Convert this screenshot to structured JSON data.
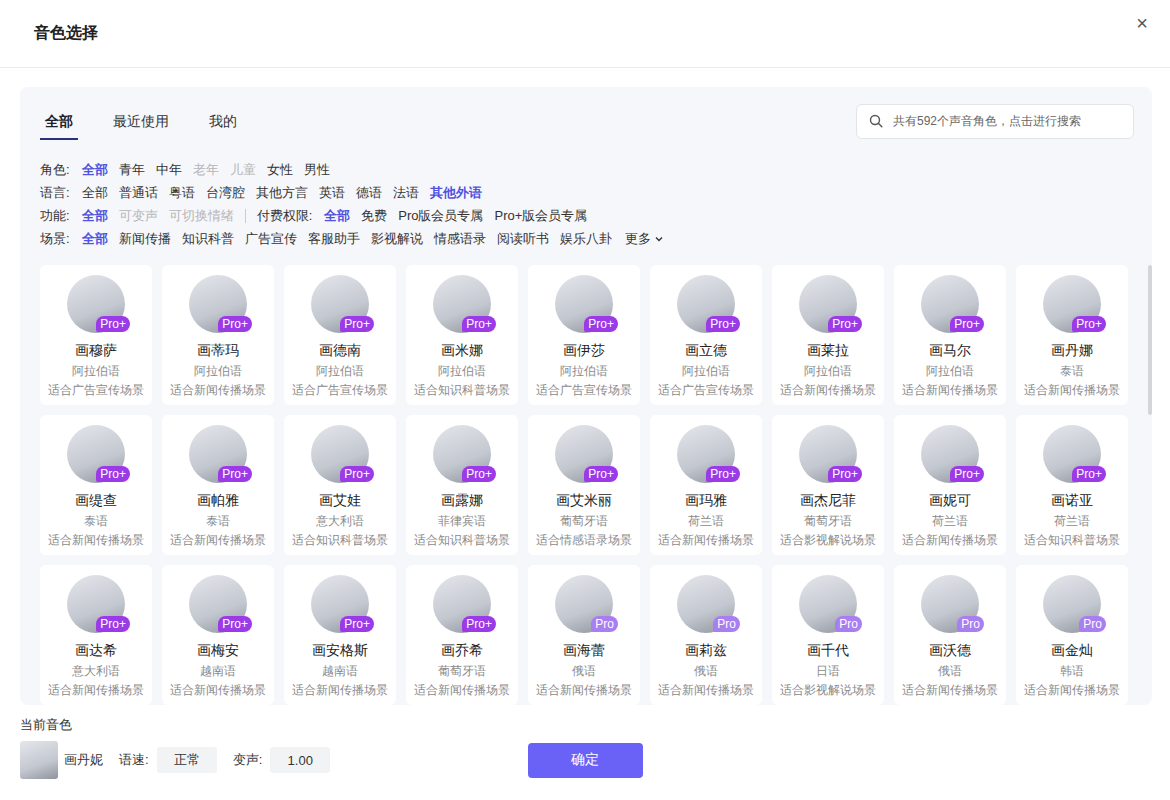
{
  "window": {
    "title": "音色选择",
    "close": "×"
  },
  "tabs": [
    {
      "label": "全部",
      "selected": true
    },
    {
      "label": "最近使用",
      "selected": false
    },
    {
      "label": "我的",
      "selected": false
    }
  ],
  "search": {
    "placeholder": "共有592个声音角色，点击进行搜索"
  },
  "filters": [
    {
      "groups": [
        {
          "label": "角色:",
          "options": [
            {
              "label": "全部",
              "selected": true,
              "disabled": false
            },
            {
              "label": "青年",
              "selected": false,
              "disabled": false
            },
            {
              "label": "中年",
              "selected": false,
              "disabled": false
            },
            {
              "label": "老年",
              "selected": false,
              "disabled": true
            },
            {
              "label": "儿童",
              "selected": false,
              "disabled": true
            },
            {
              "label": "女性",
              "selected": false,
              "disabled": false
            },
            {
              "label": "男性",
              "selected": false,
              "disabled": false
            }
          ]
        }
      ],
      "more": null
    },
    {
      "groups": [
        {
          "label": "语言:",
          "options": [
            {
              "label": "全部",
              "selected": false,
              "disabled": false
            },
            {
              "label": "普通话",
              "selected": false,
              "disabled": false
            },
            {
              "label": "粤语",
              "selected": false,
              "disabled": false
            },
            {
              "label": "台湾腔",
              "selected": false,
              "disabled": false
            },
            {
              "label": "其他方言",
              "selected": false,
              "disabled": false
            },
            {
              "label": "英语",
              "selected": false,
              "disabled": false
            },
            {
              "label": "德语",
              "selected": false,
              "disabled": false
            },
            {
              "label": "法语",
              "selected": false,
              "disabled": false
            },
            {
              "label": "其他外语",
              "selected": true,
              "disabled": false
            }
          ]
        }
      ],
      "more": null
    },
    {
      "groups": [
        {
          "label": "功能:",
          "options": [
            {
              "label": "全部",
              "selected": true,
              "disabled": false
            },
            {
              "label": "可变声",
              "selected": false,
              "disabled": true
            },
            {
              "label": "可切换情绪",
              "selected": false,
              "disabled": true
            }
          ]
        },
        {
          "label": "付费权限:",
          "options": [
            {
              "label": "全部",
              "selected": true,
              "disabled": false
            },
            {
              "label": "免费",
              "selected": false,
              "disabled": false
            },
            {
              "label": "Pro版会员专属",
              "selected": false,
              "disabled": false
            },
            {
              "label": "Pro+版会员专属",
              "selected": false,
              "disabled": false
            }
          ]
        }
      ],
      "more": null
    },
    {
      "groups": [
        {
          "label": "场景:",
          "options": [
            {
              "label": "全部",
              "selected": true,
              "disabled": false
            },
            {
              "label": "新闻传播",
              "selected": false,
              "disabled": false
            },
            {
              "label": "知识科普",
              "selected": false,
              "disabled": false
            },
            {
              "label": "广告宣传",
              "selected": false,
              "disabled": false
            },
            {
              "label": "客服助手",
              "selected": false,
              "disabled": false
            },
            {
              "label": "影视解说",
              "selected": false,
              "disabled": false
            },
            {
              "label": "情感语录",
              "selected": false,
              "disabled": false
            },
            {
              "label": "阅读听书",
              "selected": false,
              "disabled": false
            },
            {
              "label": "娱乐八卦",
              "selected": false,
              "disabled": false
            }
          ]
        }
      ],
      "more": "更多"
    }
  ],
  "voices": [
    {
      "name": "画穆萨",
      "language": "阿拉伯语",
      "scene": "适合广告宣传场景",
      "badge": "Pro+",
      "color": "#9b3ae6"
    },
    {
      "name": "画蒂玛",
      "language": "阿拉伯语",
      "scene": "适合新闻传播场景",
      "badge": "Pro+",
      "color": "#9b3ae6"
    },
    {
      "name": "画德南",
      "language": "阿拉伯语",
      "scene": "适合广告宣传场景",
      "badge": "Pro+",
      "color": "#9b3ae6"
    },
    {
      "name": "画米娜",
      "language": "阿拉伯语",
      "scene": "适合知识科普场景",
      "badge": "Pro+",
      "color": "#9b3ae6"
    },
    {
      "name": "画伊莎",
      "language": "阿拉伯语",
      "scene": "适合广告宣传场景",
      "badge": "Pro+",
      "color": "#9b3ae6"
    },
    {
      "name": "画立德",
      "language": "阿拉伯语",
      "scene": "适合广告宣传场景",
      "badge": "Pro+",
      "color": "#9b3ae6"
    },
    {
      "name": "画莱拉",
      "language": "阿拉伯语",
      "scene": "适合新闻传播场景",
      "badge": "Pro+",
      "color": "#9b3ae6"
    },
    {
      "name": "画马尔",
      "language": "阿拉伯语",
      "scene": "适合新闻传播场景",
      "badge": "Pro+",
      "color": "#9b3ae6"
    },
    {
      "name": "画丹娜",
      "language": "泰语",
      "scene": "适合新闻传播场景",
      "badge": "Pro+",
      "color": "#9b3ae6"
    },
    {
      "name": "画缇查",
      "language": "泰语",
      "scene": "适合新闻传播场景",
      "badge": "Pro+",
      "color": "#9b3ae6"
    },
    {
      "name": "画帕雅",
      "language": "泰语",
      "scene": "适合新闻传播场景",
      "badge": "Pro+",
      "color": "#9b3ae6"
    },
    {
      "name": "画艾娃",
      "language": "意大利语",
      "scene": "适合知识科普场景",
      "badge": "Pro+",
      "color": "#9b3ae6"
    },
    {
      "name": "画露娜",
      "language": "菲律宾语",
      "scene": "适合知识科普场景",
      "badge": "Pro+",
      "color": "#9b3ae6"
    },
    {
      "name": "画艾米丽",
      "language": "葡萄牙语",
      "scene": "适合情感语录场景",
      "badge": "Pro+",
      "color": "#9b3ae6"
    },
    {
      "name": "画玛雅",
      "language": "荷兰语",
      "scene": "适合新闻传播场景",
      "badge": "Pro+",
      "color": "#9b3ae6"
    },
    {
      "name": "画杰尼菲",
      "language": "葡萄牙语",
      "scene": "适合影视解说场景",
      "badge": "Pro+",
      "color": "#9b3ae6"
    },
    {
      "name": "画妮可",
      "language": "荷兰语",
      "scene": "适合新闻传播场景",
      "badge": "Pro+",
      "color": "#9b3ae6"
    },
    {
      "name": "画诺亚",
      "language": "荷兰语",
      "scene": "适合知识科普场景",
      "badge": "Pro+",
      "color": "#9b3ae6"
    },
    {
      "name": "画达希",
      "language": "意大利语",
      "scene": "适合新闻传播场景",
      "badge": "Pro+",
      "color": "#9b3ae6"
    },
    {
      "name": "画梅安",
      "language": "越南语",
      "scene": "适合新闻传播场景",
      "badge": "Pro+",
      "color": "#9b3ae6"
    },
    {
      "name": "画安格斯",
      "language": "越南语",
      "scene": "适合新闻传播场景",
      "badge": "Pro+",
      "color": "#9b3ae6"
    },
    {
      "name": "画乔希",
      "language": "葡萄牙语",
      "scene": "适合新闻传播场景",
      "badge": "Pro+",
      "color": "#9b3ae6"
    },
    {
      "name": "画海蕾",
      "language": "俄语",
      "scene": "适合新闻传播场景",
      "badge": "Pro",
      "color": "#a87ef0"
    },
    {
      "name": "画莉兹",
      "language": "俄语",
      "scene": "适合新闻传播场景",
      "badge": "Pro",
      "color": "#a87ef0"
    },
    {
      "name": "画千代",
      "language": "日语",
      "scene": "适合影视解说场景",
      "badge": "Pro",
      "color": "#a87ef0"
    },
    {
      "name": "画沃德",
      "language": "俄语",
      "scene": "适合新闻传播场景",
      "badge": "Pro",
      "color": "#a87ef0"
    },
    {
      "name": "画金灿",
      "language": "韩语",
      "scene": "适合新闻传播场景",
      "badge": "Pro",
      "color": "#a87ef0"
    }
  ],
  "current": {
    "label": "当前音色",
    "name": "画丹妮",
    "speed_label": "语速:",
    "speed": "正常",
    "pitch_label": "变声:",
    "pitch": "1.00"
  },
  "buttons": [
    "确定"
  ]
}
